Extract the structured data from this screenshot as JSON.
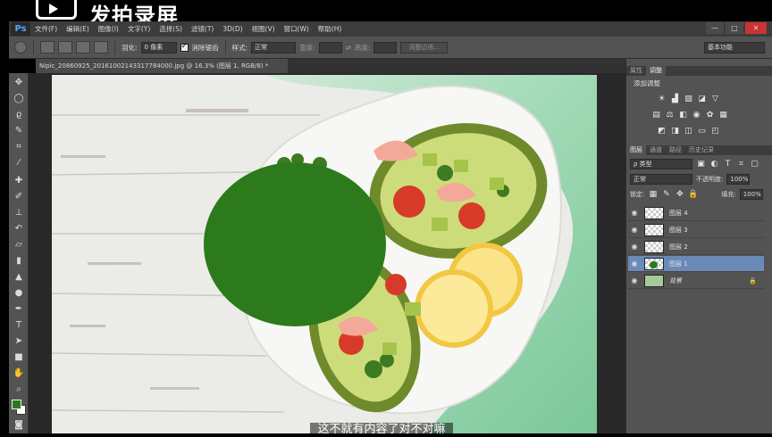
{
  "recorder": {
    "brand_text": "发拍录屏"
  },
  "app": {
    "logo": "Ps"
  },
  "menu": {
    "items": [
      "文件(F)",
      "编辑(E)",
      "图像(I)",
      "文字(Y)",
      "选择(S)",
      "滤镜(T)",
      "3D(D)",
      "视图(V)",
      "窗口(W)",
      "帮助(H)"
    ]
  },
  "window_buttons": {
    "minimize": "—",
    "maximize": "□",
    "close": "✕"
  },
  "options": {
    "feather_label": "羽化:",
    "feather_value": "0 像素",
    "antialias_label": "消除锯齿",
    "style_label": "样式:",
    "style_value": "正常",
    "width_label": "宽度:",
    "height_label": "高度:",
    "refine_edge": "调整边缘...",
    "workspace": "基本功能"
  },
  "document": {
    "tab_title": "Nipic_20860925_20161002143317784000.jpg @ 16.3% (图层 1, RGB/8) *"
  },
  "tools": [
    "move-tool",
    "marquee-tool",
    "lasso-tool",
    "quick-select-tool",
    "crop-tool",
    "eyedropper-tool",
    "healing-tool",
    "brush-tool",
    "stamp-tool",
    "history-brush-tool",
    "eraser-tool",
    "gradient-tool",
    "blur-tool",
    "dodge-tool",
    "pen-tool",
    "type-tool",
    "path-select-tool",
    "shape-tool",
    "hand-tool",
    "zoom-tool"
  ],
  "colors": {
    "foreground": "#2a7a1a",
    "background": "#ffffff",
    "shape_fill": "#2c7a1c",
    "selected_layer": "#6a8ab8"
  },
  "panels": {
    "top_tabs": [
      "属性",
      "调整"
    ],
    "adjust_title": "添加调整",
    "layer_tabs": [
      "图层",
      "通道",
      "路径",
      "历史记录"
    ],
    "filter_label": "ρ 类型",
    "blend_mode": "正常",
    "opacity_label": "不透明度:",
    "opacity_value": "100%",
    "lock_label": "锁定:",
    "fill_label": "填充:",
    "fill_value": "100%",
    "layers": [
      {
        "name": "图层 4",
        "selected": false,
        "italic": false
      },
      {
        "name": "图层 3",
        "selected": false,
        "italic": false
      },
      {
        "name": "图层 2",
        "selected": false,
        "italic": false
      },
      {
        "name": "图层 1",
        "selected": true,
        "italic": false
      },
      {
        "name": "背景",
        "selected": false,
        "italic": true
      }
    ]
  },
  "subtitle": "这不就有内容了对不对嘛"
}
